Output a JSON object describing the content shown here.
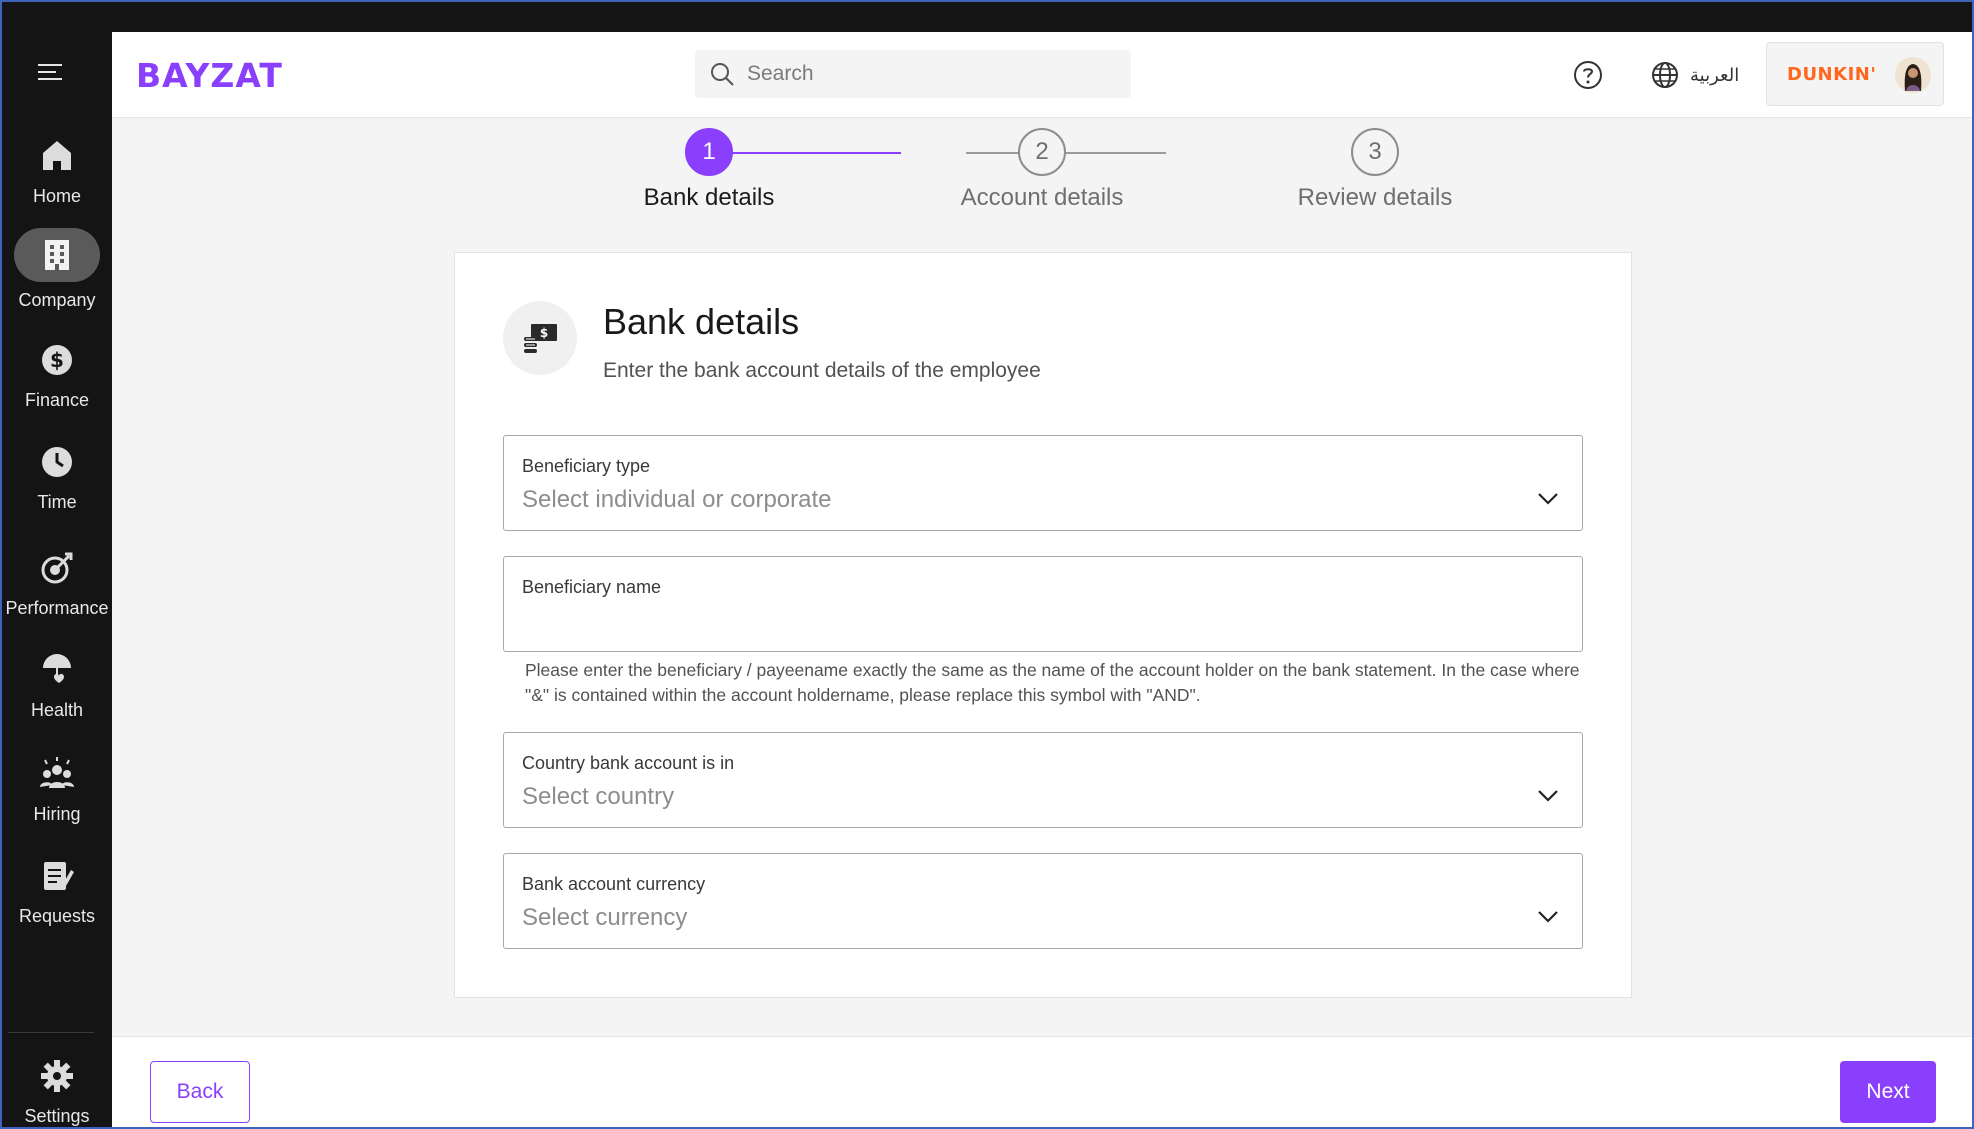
{
  "sidebar": {
    "items": [
      {
        "label": "Home",
        "icon": "home-icon"
      },
      {
        "label": "Company",
        "icon": "building-icon",
        "active": true
      },
      {
        "label": "Finance",
        "icon": "dollar-icon"
      },
      {
        "label": "Time",
        "icon": "clock-icon"
      },
      {
        "label": "Performance",
        "icon": "target-icon"
      },
      {
        "label": "Health",
        "icon": "umbrella-heart-icon"
      },
      {
        "label": "Hiring",
        "icon": "people-icon"
      },
      {
        "label": "Requests",
        "icon": "clipboard-icon"
      }
    ],
    "settings_label": "Settings"
  },
  "header": {
    "logo": "BAYZAT",
    "search_placeholder": "Search",
    "language_label": "العربية",
    "company_brand": "DUNKIN'"
  },
  "stepper": {
    "steps": [
      {
        "number": "1",
        "label": "Bank details",
        "state": "active"
      },
      {
        "number": "2",
        "label": "Account details",
        "state": "pending"
      },
      {
        "number": "3",
        "label": "Review details",
        "state": "pending"
      }
    ]
  },
  "form": {
    "title": "Bank details",
    "subtitle": "Enter the bank account details of the employee",
    "beneficiary_type": {
      "label": "Beneficiary type",
      "placeholder": "Select individual or corporate"
    },
    "beneficiary_name": {
      "label": "Beneficiary name",
      "value": ""
    },
    "helper_text": "Please enter the beneficiary / payeename exactly the same as the name of the account holder on the bank statement. In the case where \"&\" is contained within the account holdername, please replace this symbol with \"AND\".",
    "country": {
      "label": "Country bank account is in",
      "placeholder": "Select country"
    },
    "currency": {
      "label": "Bank account currency",
      "placeholder": "Select currency"
    }
  },
  "footer": {
    "back_label": "Back",
    "next_label": "Next"
  },
  "colors": {
    "accent": "#8a3ffc",
    "brand_orange": "#ff671f"
  }
}
